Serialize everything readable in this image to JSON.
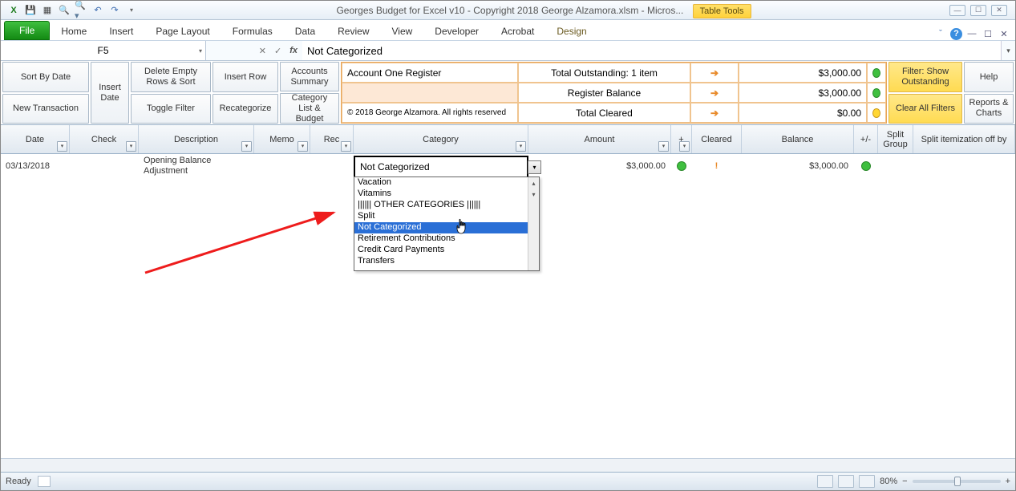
{
  "titlebar": {
    "title": "Georges Budget for Excel v10 - Copyright 2018 George Alzamora.xlsm  -  Micros...",
    "table_tools": "Table Tools"
  },
  "ribbon": {
    "file": "File",
    "home": "Home",
    "insert": "Insert",
    "page_layout": "Page Layout",
    "formulas": "Formulas",
    "data": "Data",
    "review": "Review",
    "view": "View",
    "developer": "Developer",
    "acrobat": "Acrobat",
    "design": "Design"
  },
  "formula_bar": {
    "cell_ref": "F5",
    "value": "Not Categorized"
  },
  "toolbar": {
    "sort_by_date": "Sort By Date",
    "new_transaction": "New Transaction",
    "insert_date": "Insert Date",
    "delete_empty": "Delete Empty Rows & Sort",
    "toggle_filter": "Toggle Filter",
    "insert_row": "Insert Row",
    "recategorize": "Recategorize",
    "accounts_summary": "Accounts Summary",
    "category_list": "Category List & Budget",
    "filter_show": "Filter: Show Outstanding",
    "clear_filters": "Clear All Filters",
    "help": "Help",
    "reports": "Reports & Charts"
  },
  "summary": {
    "register_name": "Account One Register",
    "copyright": "© 2018 George Alzamora. All rights reserved",
    "outstanding_label": "Total Outstanding: 1 item",
    "outstanding_amt": "$3,000.00",
    "balance_label": "Register Balance",
    "balance_amt": "$3,000.00",
    "cleared_label": "Total Cleared",
    "cleared_amt": "$0.00"
  },
  "columns": {
    "date": "Date",
    "check": "Check",
    "description": "Description",
    "memo": "Memo",
    "rec": "Rec",
    "category": "Category",
    "amount": "Amount",
    "plus": "+",
    "cleared": "Cleared",
    "balance": "Balance",
    "pm": "+/-",
    "split_group": "Split Group",
    "split_off": "Split itemization off by"
  },
  "row1": {
    "date": "03/13/2018",
    "description": "Opening Balance Adjustment",
    "amount": "$3,000.00",
    "cleared_mark": "!",
    "balance": "$3,000.00"
  },
  "cell_editor": {
    "value": "Not Categorized"
  },
  "dropdown": {
    "items": [
      "Vacation",
      "Vitamins",
      "|||||| OTHER CATEGORIES ||||||",
      "Split",
      "Not Categorized",
      "Retirement Contributions",
      "Credit Card Payments",
      "Transfers"
    ],
    "selected_index": 4
  },
  "statusbar": {
    "ready": "Ready",
    "zoom": "80%"
  }
}
